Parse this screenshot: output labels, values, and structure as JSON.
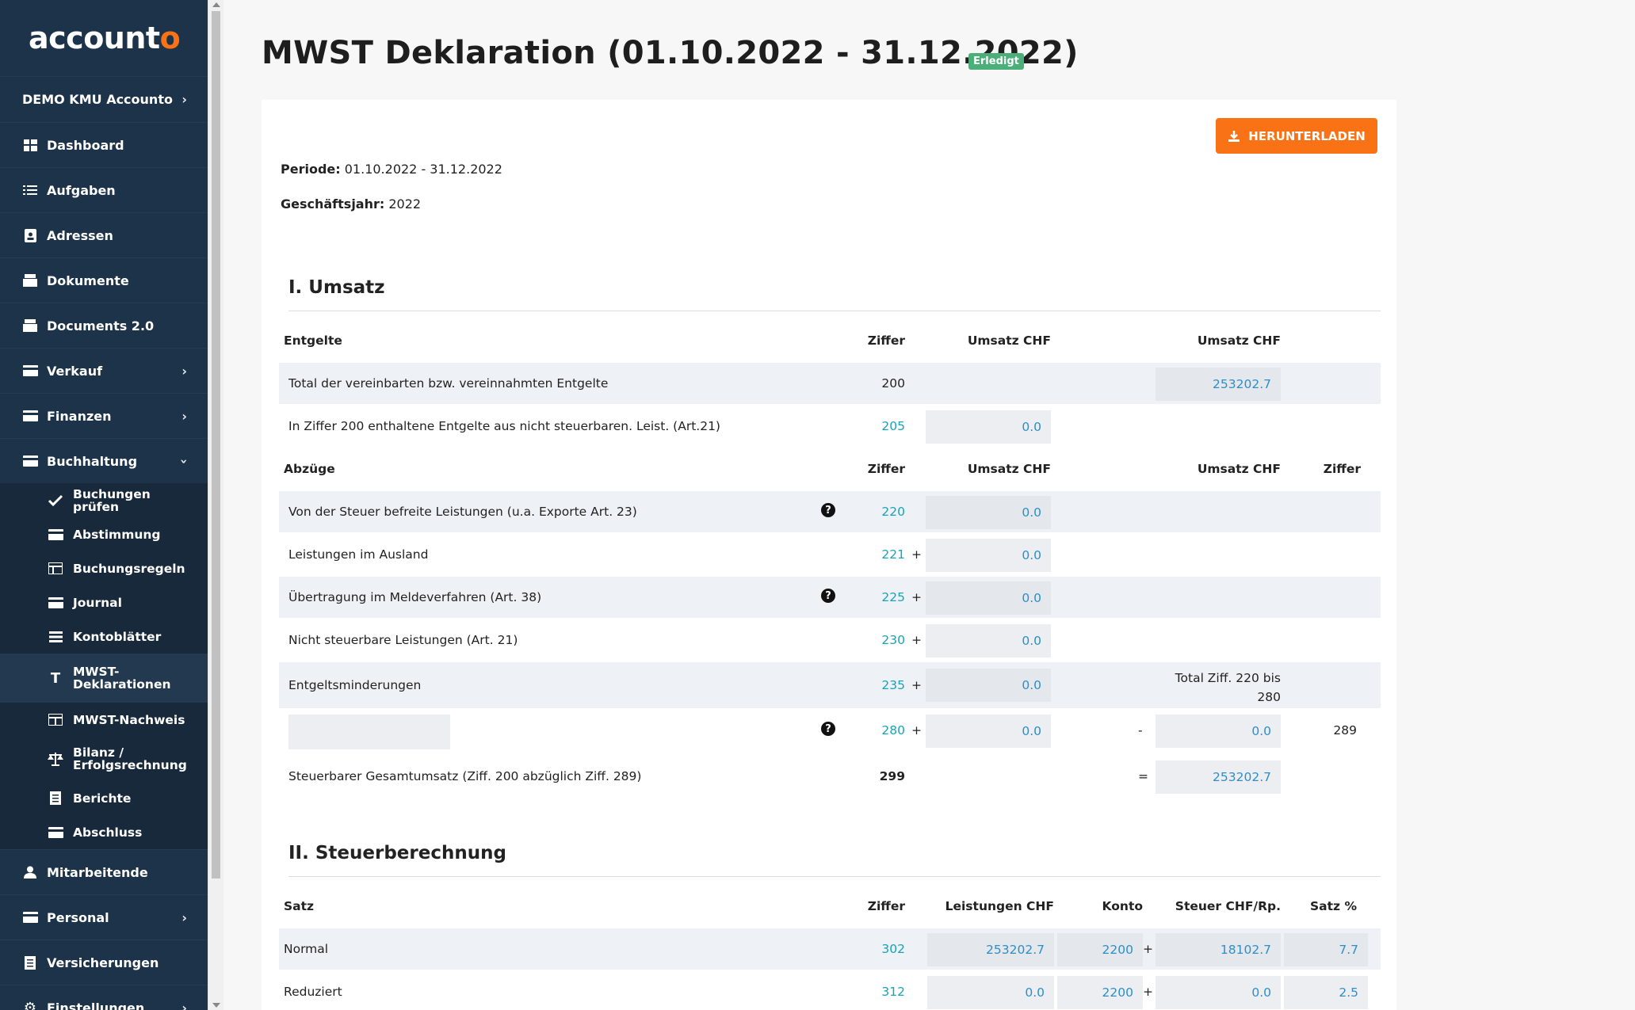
{
  "app": {
    "logo_main": "account",
    "logo_accent": "o"
  },
  "sidebar": {
    "company": "DEMO KMU Accounto",
    "items": [
      {
        "label": "Dashboard",
        "icon": "dashboard-icon"
      },
      {
        "label": "Aufgaben",
        "icon": "tasks-icon"
      },
      {
        "label": "Adressen",
        "icon": "address-book-icon"
      },
      {
        "label": "Dokumente",
        "icon": "documents-icon"
      },
      {
        "label": "Documents 2.0",
        "icon": "documents-icon"
      },
      {
        "label": "Verkauf",
        "icon": "sales-icon"
      },
      {
        "label": "Finanzen",
        "icon": "finance-icon"
      },
      {
        "label": "Buchhaltung",
        "icon": "accounting-icon"
      }
    ],
    "sub_items": [
      {
        "label": "Buchungen prüfen",
        "icon": "check-icon"
      },
      {
        "label": "Abstimmung",
        "icon": "reconcile-icon"
      },
      {
        "label": "Buchungsregeln",
        "icon": "rules-icon"
      },
      {
        "label": "Journal",
        "icon": "journal-icon"
      },
      {
        "label": "Kontoblätter",
        "icon": "ledger-icon"
      },
      {
        "label": "MWST-Deklarationen",
        "icon": "text-icon"
      },
      {
        "label": "MWST-Nachweis",
        "icon": "table-icon"
      },
      {
        "label": "Bilanz / Erfolgsrechnung",
        "icon": "balance-icon"
      },
      {
        "label": "Berichte",
        "icon": "report-icon"
      },
      {
        "label": "Abschluss",
        "icon": "closing-icon"
      }
    ],
    "bottom_items": [
      {
        "label": "Mitarbeitende",
        "icon": "user-icon"
      },
      {
        "label": "Personal",
        "icon": "personnel-icon"
      },
      {
        "label": "Versicherungen",
        "icon": "insurance-icon"
      },
      {
        "label": "Einstellungen",
        "icon": "gear-icon"
      }
    ]
  },
  "page": {
    "title": "MWST Deklaration (01.10.2022 - 31.12.2022)",
    "status": "Erledigt",
    "download_label": "HERUNTERLADEN",
    "periode_label": "Periode:",
    "periode_value": "01.10.2022 - 31.12.2022",
    "gj_label": "Geschäftsjahr:",
    "gj_value": "2022"
  },
  "umsatz": {
    "title": "I. Umsatz",
    "hdr_entgelte": "Entgelte",
    "hdr_ziffer": "Ziffer",
    "hdr_umsatz": "Umsatz CHF",
    "r200_label": "Total der vereinbarten bzw. vereinnahmten Entgelte",
    "r200_ziffer": "200",
    "r200_value": "253202.7",
    "r205_label": "In Ziffer 200 enthaltene Entgelte aus nicht steuerbaren. Leist. (Art.21)",
    "r205_ziffer": "205",
    "r205_value": "0.0",
    "hdr_abzuege": "Abzüge",
    "r220_label": "Von der Steuer befreite Leistungen (u.a. Exporte Art. 23)",
    "r220_ziffer": "220",
    "r220_value": "0.0",
    "r221_label": "Leistungen im Ausland",
    "r221_ziffer": "221",
    "r221_value": "0.0",
    "r225_label": "Übertragung im Meldeverfahren (Art. 38)",
    "r225_ziffer": "225",
    "r225_value": "0.0",
    "r230_label": "Nicht steuerbare Leistungen (Art. 21)",
    "r230_ziffer": "230",
    "r230_value": "0.0",
    "r235_label": "Entgeltsminderungen",
    "r235_ziffer": "235",
    "r235_value": "0.0",
    "r235_note_1": "Total Ziff. 220 bis",
    "r235_note_2": "280",
    "r280_ziffer": "280",
    "r280_value": "0.0",
    "r289_value": "0.0",
    "r289_ziffer": "289",
    "r299_label": "Steuerbarer Gesamtumsatz (Ziff. 200 abzüglich Ziff. 289)",
    "r299_ziffer": "299",
    "r299_value": "253202.7",
    "plus": "+",
    "minus": "-",
    "equals": "="
  },
  "steuer": {
    "title": "II. Steuerberechnung",
    "hdr_satz": "Satz",
    "hdr_ziffer": "Ziffer",
    "hdr_leistungen": "Leistungen CHF",
    "hdr_konto": "Konto",
    "hdr_steuer": "Steuer CHF/Rp.",
    "hdr_satzpct": "Satz %",
    "rows": [
      {
        "label": "Normal",
        "ziffer": "302",
        "leistungen": "253202.7",
        "konto": "2200",
        "steuer": "18102.7",
        "satz": "7.7"
      },
      {
        "label": "Reduziert",
        "ziffer": "312",
        "leistungen": "0.0",
        "konto": "2200",
        "steuer": "0.0",
        "satz": "2.5"
      }
    ]
  }
}
